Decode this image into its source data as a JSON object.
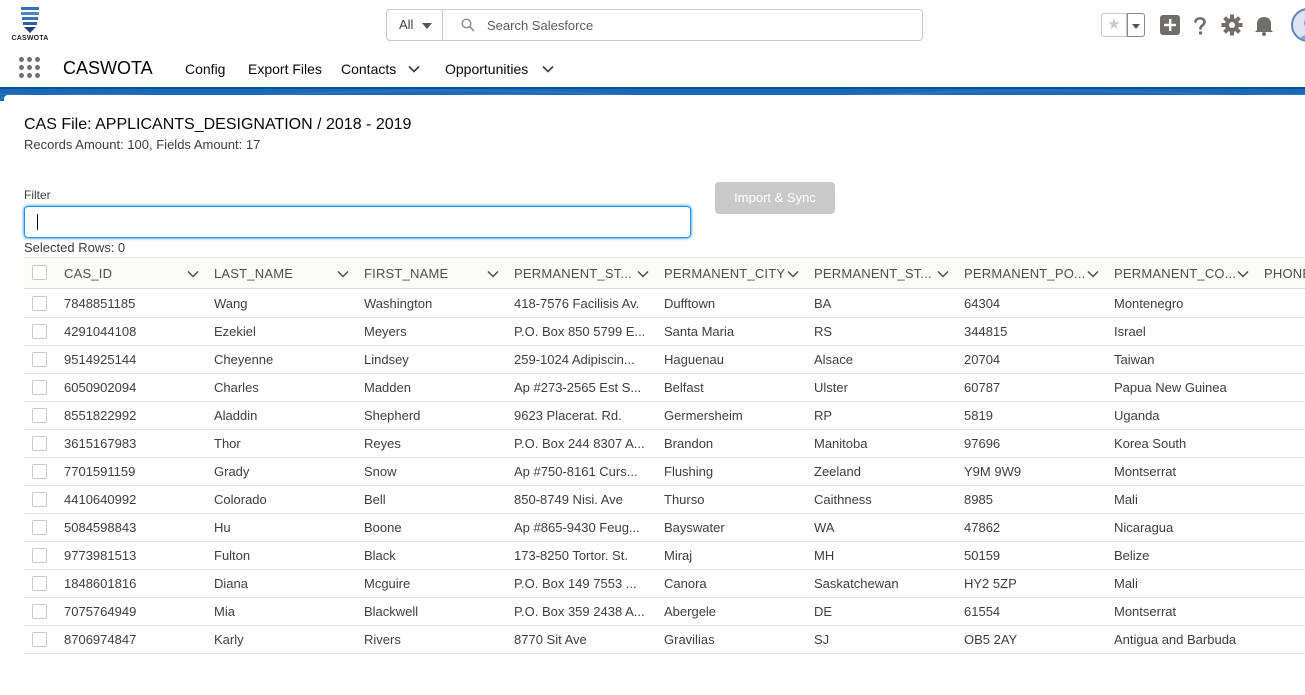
{
  "header": {
    "logo_text": "CASWOTA",
    "search": {
      "scope": "All",
      "placeholder": "Search Salesforce"
    },
    "icons": [
      "star-icon",
      "add-icon",
      "help-icon",
      "gear-icon",
      "bell-icon",
      "avatar"
    ]
  },
  "nav": {
    "app_name": "CASWOTA",
    "items": [
      {
        "label": "Config",
        "has_menu": false
      },
      {
        "label": "Export Files",
        "has_menu": false
      },
      {
        "label": "Contacts",
        "has_menu": true
      },
      {
        "label": "Opportunities",
        "has_menu": true
      }
    ]
  },
  "page": {
    "title": "CAS File: APPLICANTS_DESIGNATION / 2018 - 2019",
    "subtitle": "Records Amount: 100, Fields Amount: 17",
    "filter_label": "Filter",
    "filter_value": "",
    "import_button": "Import & Sync",
    "selected_rows": "Selected Rows: 0"
  },
  "table": {
    "columns": [
      "CAS_ID",
      "LAST_NAME",
      "FIRST_NAME",
      "PERMANENT_ST...",
      "PERMANENT_CITY",
      "PERMANENT_ST...",
      "PERMANENT_PO...",
      "PERMANENT_CO...",
      "PHONE"
    ],
    "rows": [
      [
        "7848851185",
        "Wang",
        "Washington",
        "418-7576 Facilisis Av.",
        "Dufftown",
        "BA",
        "64304",
        "Montenegro"
      ],
      [
        "4291044108",
        "Ezekiel",
        "Meyers",
        "P.O. Box 850 5799 E...",
        "Santa Maria",
        "RS",
        "344815",
        "Israel"
      ],
      [
        "9514925144",
        "Cheyenne",
        "Lindsey",
        "259-1024 Adipiscin...",
        "Haguenau",
        "Alsace",
        "20704",
        "Taiwan"
      ],
      [
        "6050902094",
        "Charles",
        "Madden",
        "Ap #273-2565 Est S...",
        "Belfast",
        "Ulster",
        "60787",
        "Papua New Guinea"
      ],
      [
        "8551822992",
        "Aladdin",
        "Shepherd",
        "9623 Placerat. Rd.",
        "Germersheim",
        "RP",
        "5819",
        "Uganda"
      ],
      [
        "3615167983",
        "Thor",
        "Reyes",
        "P.O. Box 244 8307 A...",
        "Brandon",
        "Manitoba",
        "97696",
        "Korea South"
      ],
      [
        "7701591159",
        "Grady",
        "Snow",
        "Ap #750-8161 Curs...",
        "Flushing",
        "Zeeland",
        "Y9M 9W9",
        "Montserrat"
      ],
      [
        "4410640992",
        "Colorado",
        "Bell",
        "850-8749 Nisi. Ave",
        "Thurso",
        "Caithness",
        "8985",
        "Mali"
      ],
      [
        "5084598843",
        "Hu",
        "Boone",
        "Ap #865-9430 Feug...",
        "Bayswater",
        "WA",
        "47862",
        "Nicaragua"
      ],
      [
        "9773981513",
        "Fulton",
        "Black",
        "173-8250 Tortor. St.",
        "Miraj",
        "MH",
        "50159",
        "Belize"
      ],
      [
        "1848601816",
        "Diana",
        "Mcguire",
        "P.O. Box 149 7553 ...",
        "Canora",
        "Saskatchewan",
        "HY2 5ZP",
        "Mali"
      ],
      [
        "7075764949",
        "Mia",
        "Blackwell",
        "P.O. Box 359 2438 A...",
        "Abergele",
        "DE",
        "61554",
        "Montserrat"
      ],
      [
        "8706974847",
        "Karly",
        "Rivers",
        "8770 Sit Ave",
        "Gravilias",
        "SJ",
        "OB5 2AY",
        "Antigua and Barbuda"
      ]
    ]
  },
  "colors": {
    "brand_band": "#1b6ab8",
    "focus": "#1b96ff",
    "disabled_button": "#c9c9c9"
  }
}
